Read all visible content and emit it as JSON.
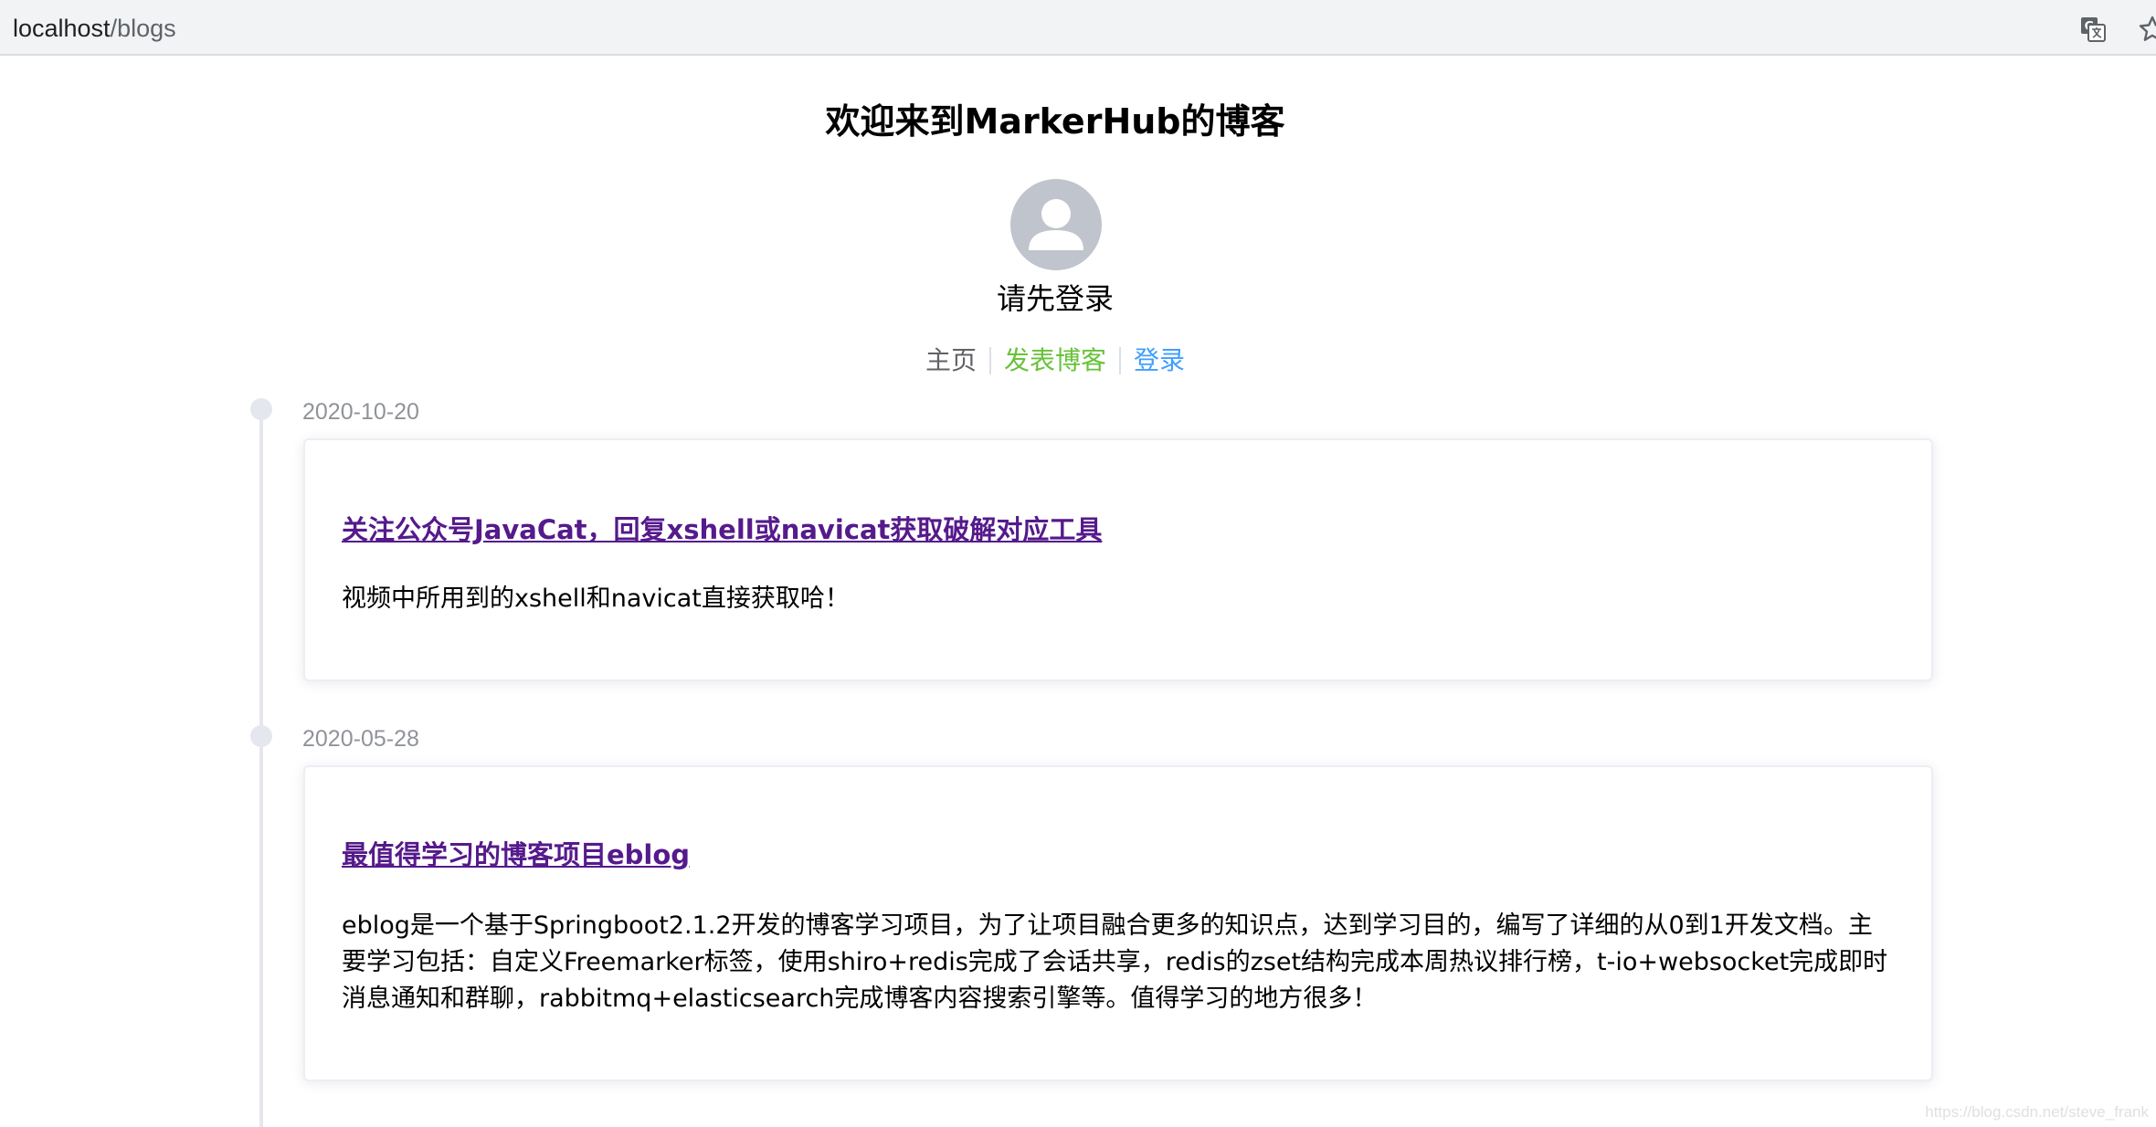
{
  "browser": {
    "url_host": "localhost",
    "url_path": "/blogs",
    "icons": [
      "translate-icon",
      "bookmark-star-icon"
    ]
  },
  "header": {
    "title": "欢迎来到MarkerHub的博客",
    "avatar_icon": "user-avatar-icon",
    "login_hint": "请先登录"
  },
  "nav": {
    "home": "主页",
    "post": "发表博客",
    "login": "登录"
  },
  "colors": {
    "nav_post": "#67c23a",
    "nav_login": "#409eff",
    "visited_link": "#551a8b",
    "timeline": "#e4e7ed"
  },
  "blogs": [
    {
      "date": "2020-10-20",
      "title": "关注公众号JavaCat，回复xshell或navicat获取破解对应工具",
      "description": "视频中所用到的xshell和navicat直接获取哈！"
    },
    {
      "date": "2020-05-28",
      "title": "最值得学习的博客项目eblog",
      "description": "eblog是一个基于Springboot2.1.2开发的博客学习项目，为了让项目融合更多的知识点，达到学习目的，编写了详细的从0到1开发文档。主要学习包括：自定义Freemarker标签，使用shiro+redis完成了会话共享，redis的zset结构完成本周热议排行榜，t-io+websocket完成即时消息通知和群聊，rabbitmq+elasticsearch完成博客内容搜索引擎等。值得学习的地方很多！"
    }
  ],
  "watermark": "https://blog.csdn.net/steve_frank"
}
